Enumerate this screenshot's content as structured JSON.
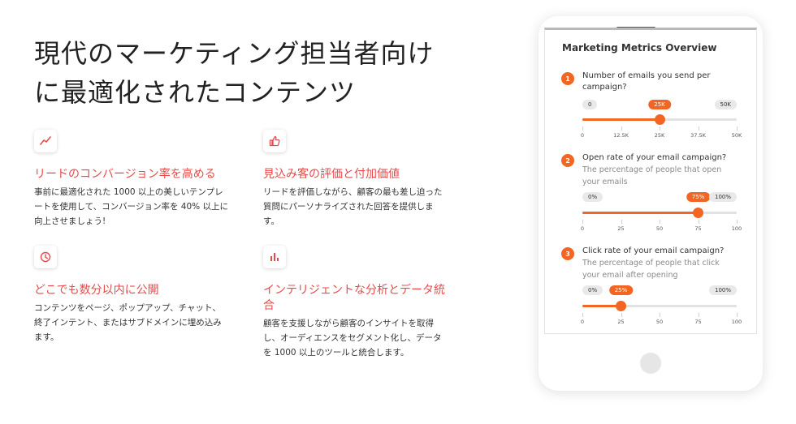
{
  "headline": {
    "line1": "現代のマーケティング担当者向け",
    "line2": "に最適化されたコンテンツ"
  },
  "colors": {
    "accent": "#f26522",
    "feature_title": "#e84a4a"
  },
  "features": [
    {
      "icon": "trend-line-icon",
      "title": "リードのコンバージョン率を高める",
      "desc": "事前に最適化された 1000 以上の美しいテンプレートを使用して、コンバージョン率を 40% 以上に向上させましょう!"
    },
    {
      "icon": "thumbs-up-icon",
      "title": "見込み客の評価と付加価値",
      "desc": "リードを評価しながら、顧客の最も差し迫った質問にパーソナライズされた回答を提供します。"
    },
    {
      "icon": "clock-icon",
      "title": "どこでも数分以内に公開",
      "desc": "コンテンツをページ、ポップアップ、チャット、終了インテント、またはサブドメインに埋め込みます。"
    },
    {
      "icon": "bar-chart-icon",
      "title": "インテリジェントな分析とデータ統合",
      "desc": "顧客を支援しながら顧客のインサイトを取得し、オーディエンスをセグメント化し、データを 1000 以上のツールと統合します。"
    }
  ],
  "mockup": {
    "title": "Marketing Metrics Overview",
    "metrics": [
      {
        "number": "1",
        "question": "Number of emails you send per campaign?",
        "subtext": "",
        "min_label": "0",
        "max_label": "50K",
        "value_label": "25K",
        "value_fraction": 0.5,
        "ticks": [
          "0",
          "12.5K",
          "25K",
          "37.5K",
          "50K"
        ]
      },
      {
        "number": "2",
        "question": "Open rate of your email campaign?",
        "subtext": "The percentage of people that open your emails",
        "min_label": "0%",
        "max_label": "100%",
        "value_label": "75%",
        "value_fraction": 0.75,
        "ticks": [
          "0",
          "25",
          "50",
          "75",
          "100"
        ]
      },
      {
        "number": "3",
        "question": "Click rate of your email campaign?",
        "subtext": "The percentage of people that click your email after opening",
        "min_label": "0%",
        "max_label": "100%",
        "value_label": "25%",
        "value_fraction": 0.25,
        "ticks": [
          "0",
          "25",
          "50",
          "75",
          "100"
        ]
      }
    ]
  }
}
